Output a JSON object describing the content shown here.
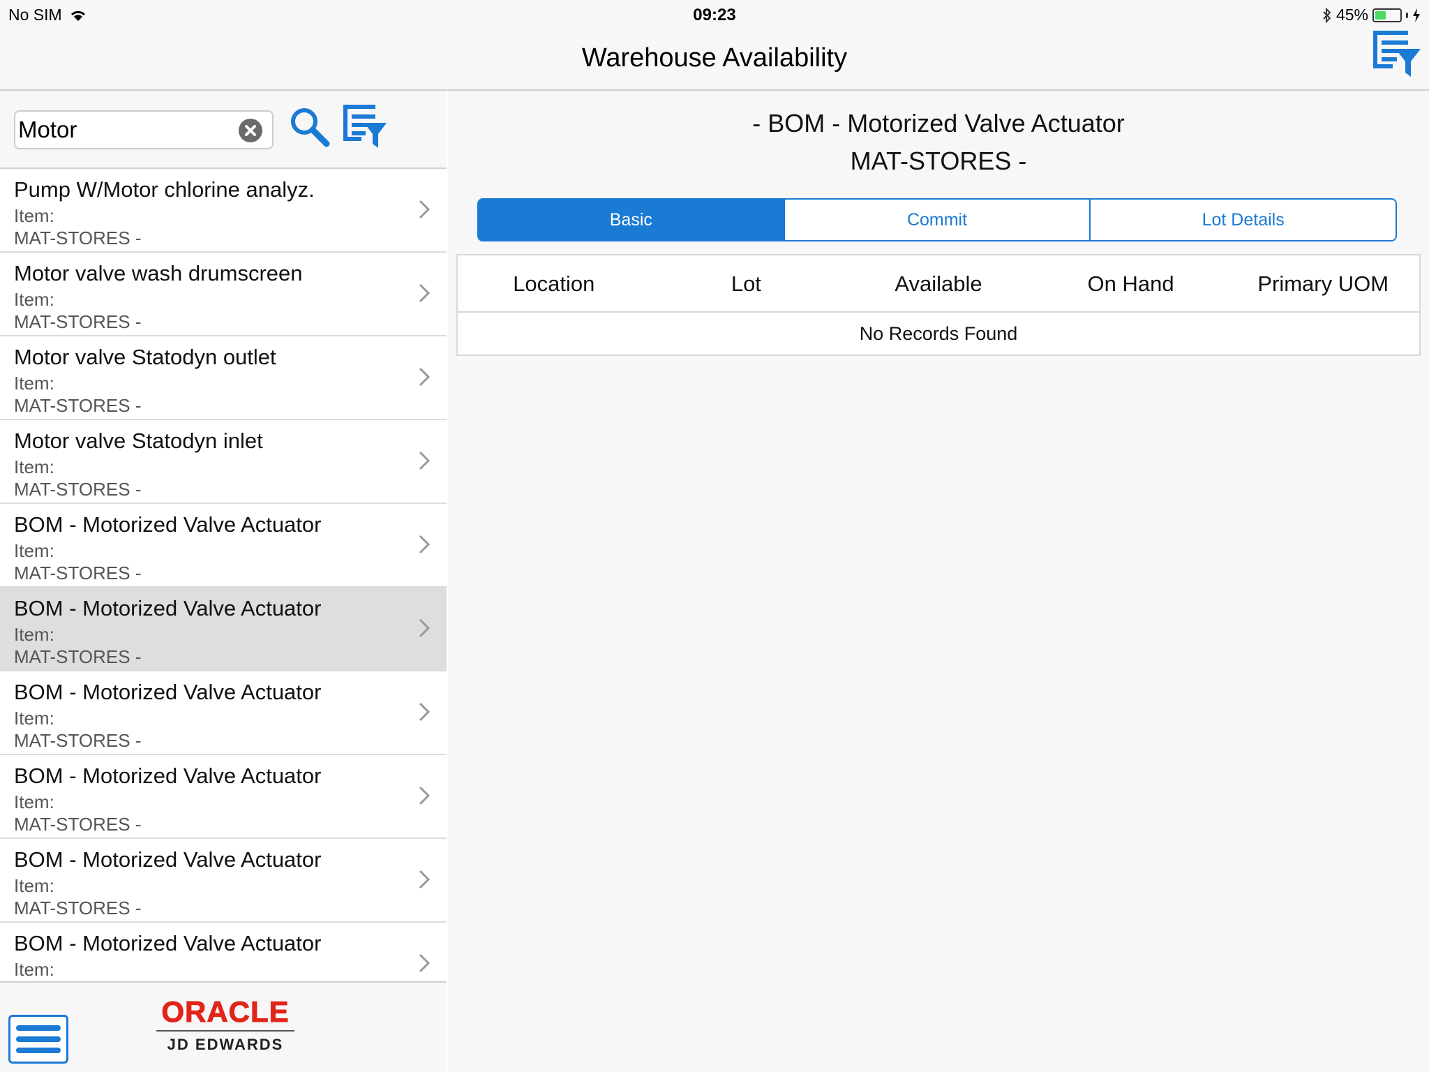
{
  "status_bar": {
    "carrier": "No SIM",
    "time": "09:23",
    "battery_percent": "45%",
    "battery_level": 0.45,
    "battery_color": "#4cd964"
  },
  "nav": {
    "title": "Warehouse Availability",
    "filter_icon": "filter-list-icon"
  },
  "search": {
    "value": "Motor",
    "placeholder": ""
  },
  "list": {
    "items": [
      {
        "title": "Pump W/Motor chlorine analyz.",
        "sub1": "Item:",
        "sub2": "MAT-STORES -"
      },
      {
        "title": "Motor valve wash drumscreen",
        "sub1": "Item:",
        "sub2": "MAT-STORES -"
      },
      {
        "title": "Motor valve Statodyn outlet",
        "sub1": "Item:",
        "sub2": "MAT-STORES -"
      },
      {
        "title": "Motor valve Statodyn inlet",
        "sub1": "Item:",
        "sub2": "MAT-STORES -"
      },
      {
        "title": "BOM - Motorized Valve Actuator",
        "sub1": "Item:",
        "sub2": "MAT-STORES -"
      },
      {
        "title": "BOM - Motorized Valve Actuator",
        "sub1": "Item:",
        "sub2": "MAT-STORES -"
      },
      {
        "title": "BOM - Motorized Valve Actuator",
        "sub1": "Item:",
        "sub2": "MAT-STORES -"
      },
      {
        "title": "BOM - Motorized Valve Actuator",
        "sub1": "Item:",
        "sub2": "MAT-STORES -"
      },
      {
        "title": "BOM - Motorized Valve Actuator",
        "sub1": "Item:",
        "sub2": "MAT-STORES -"
      },
      {
        "title": "BOM - Motorized Valve Actuator",
        "sub1": "Item:",
        "sub2": ""
      }
    ],
    "selected_index": 5
  },
  "footer": {
    "logo_top": "ORACLE",
    "logo_bottom": "JD EDWARDS"
  },
  "detail": {
    "title_line1": "- BOM - Motorized Valve Actuator",
    "title_line2": "MAT-STORES -",
    "tabs": [
      {
        "label": "Basic"
      },
      {
        "label": "Commit"
      },
      {
        "label": "Lot Details"
      }
    ],
    "active_tab": 0,
    "columns": [
      "Location",
      "Lot",
      "Available",
      "On Hand",
      "Primary UOM"
    ],
    "empty_message": "No Records Found"
  },
  "colors": {
    "accent": "#1a7ad4",
    "oracle_red": "#e1251b"
  }
}
